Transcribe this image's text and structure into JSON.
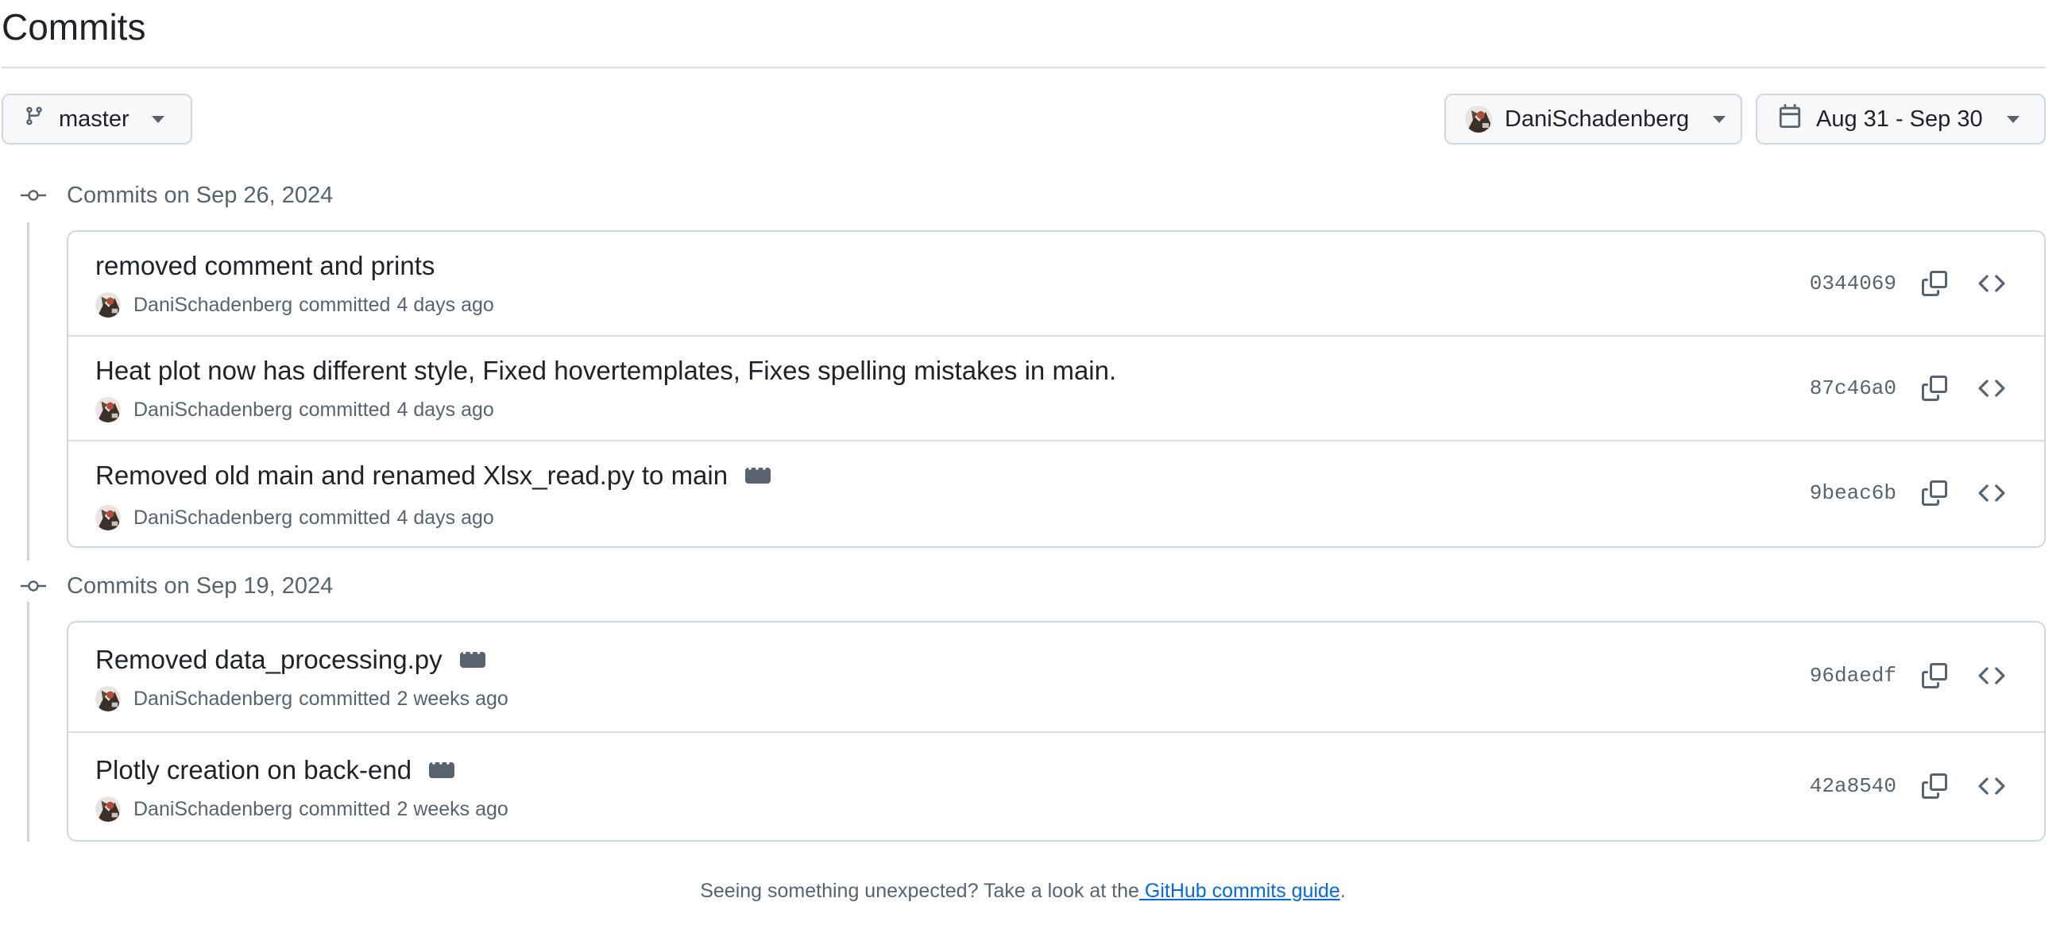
{
  "page": {
    "title": "Commits"
  },
  "filters": {
    "branch": {
      "label": "master",
      "icon": "git-branch-icon"
    },
    "user": {
      "label": "DaniSchadenberg",
      "icon": "avatar"
    },
    "date": {
      "label": "Aug 31 - Sep 30",
      "icon": "calendar-icon"
    }
  },
  "groups": [
    {
      "heading": "Commits on Sep 26, 2024",
      "commits": [
        {
          "message": "removed comment and prints",
          "author": "DaniSchadenberg",
          "action": "committed",
          "time": "4 days ago",
          "sha": "0344069",
          "has_more": false
        },
        {
          "message": "Heat plot now has different style, Fixed hovertemplates, Fixes spelling mistakes in main.",
          "author": "DaniSchadenberg",
          "action": "committed",
          "time": "4 days ago",
          "sha": "87c46a0",
          "has_more": false
        },
        {
          "message": "Removed old main and renamed Xlsx_read.py to main",
          "author": "DaniSchadenberg",
          "action": "committed",
          "time": "4 days ago",
          "sha": "9beac6b",
          "has_more": true
        }
      ]
    },
    {
      "heading": "Commits on Sep 19, 2024",
      "commits": [
        {
          "message": "Removed data_processing.py",
          "author": "DaniSchadenberg",
          "action": "committed",
          "time": "2 weeks ago",
          "sha": "96daedf",
          "has_more": true
        },
        {
          "message": "Plotly creation on back-end",
          "author": "DaniSchadenberg",
          "action": "committed",
          "time": "2 weeks ago",
          "sha": "42a8540",
          "has_more": true
        }
      ]
    }
  ],
  "footer": {
    "text": "Seeing something unexpected? Take a look at the",
    "link": " GitHub commits guide",
    "end": "."
  },
  "colors": {
    "text": "#1f2328",
    "muted": "#59636e",
    "border": "#d0d7de",
    "link": "#0969da",
    "button_bg": "#f6f8fa"
  }
}
